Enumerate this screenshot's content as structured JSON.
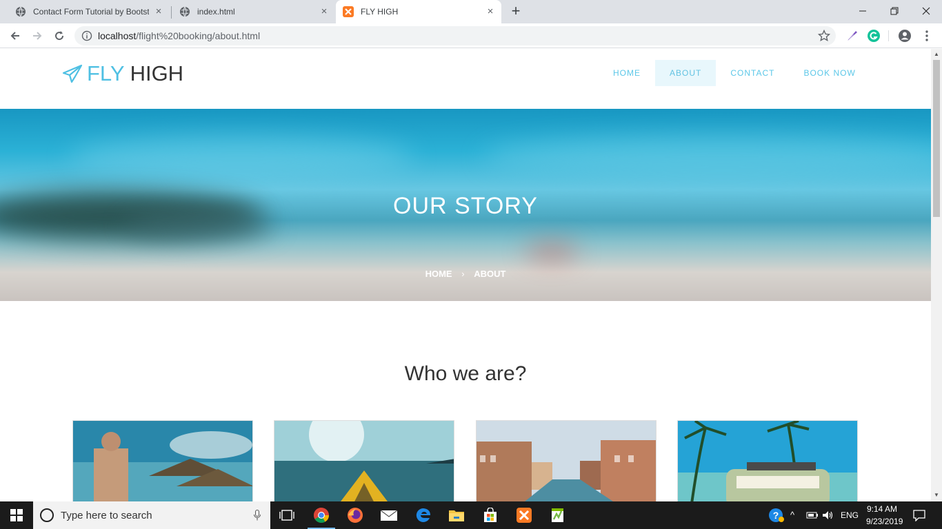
{
  "browser": {
    "tabs": [
      {
        "title": "Contact Form Tutorial by Bootstr",
        "active": false
      },
      {
        "title": "index.html",
        "active": false
      },
      {
        "title": "FLY HIGH",
        "active": true
      }
    ],
    "url_host": "localhost",
    "url_path": "/flight%20booking/about.html",
    "new_tab": "+"
  },
  "site": {
    "logo_fly": "FLY",
    "logo_high": "HIGH",
    "nav": [
      {
        "label": "HOME",
        "active": false
      },
      {
        "label": "ABOUT",
        "active": true
      },
      {
        "label": "CONTACT",
        "active": false
      },
      {
        "label": "BOOK NOW",
        "active": false
      }
    ],
    "hero_title": "OUR STORY",
    "breadcrumb_home": "HOME",
    "breadcrumb_current": "ABOUT",
    "section_title": "Who we are?",
    "accent": "#4fc0e3"
  },
  "taskbar": {
    "search_placeholder": "Type here to search",
    "language": "ENG",
    "time": "9:14 AM",
    "date": "9/23/2019"
  }
}
